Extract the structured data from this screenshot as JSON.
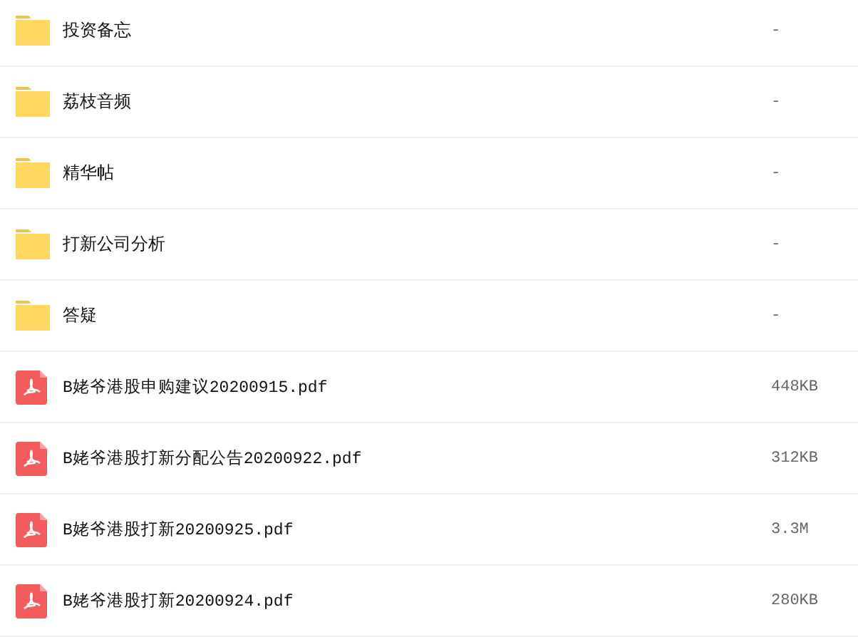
{
  "files": [
    {
      "kind": "folder",
      "name": "投资备忘",
      "size": "-"
    },
    {
      "kind": "folder",
      "name": "荔枝音频",
      "size": "-"
    },
    {
      "kind": "folder",
      "name": "精华帖",
      "size": "-"
    },
    {
      "kind": "folder",
      "name": "打新公司分析",
      "size": "-"
    },
    {
      "kind": "folder",
      "name": "答疑",
      "size": "-"
    },
    {
      "kind": "pdf",
      "name": "B姥爷港股申购建议20200915.pdf",
      "size": "448KB"
    },
    {
      "kind": "pdf",
      "name": "B姥爷港股打新分配公告20200922.pdf",
      "size": "312KB"
    },
    {
      "kind": "pdf",
      "name": "B姥爷港股打新20200925.pdf",
      "size": "3.3M"
    },
    {
      "kind": "pdf",
      "name": "B姥爷港股打新20200924.pdf",
      "size": "280KB"
    }
  ]
}
